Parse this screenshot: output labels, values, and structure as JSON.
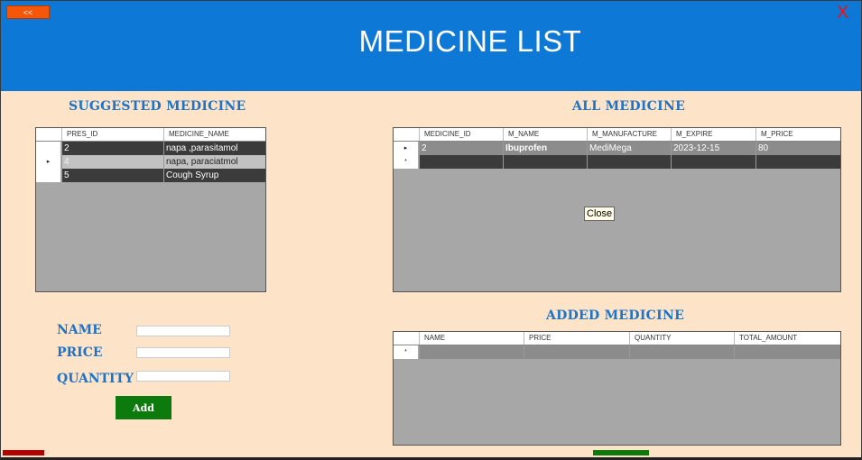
{
  "header": {
    "back_label": "<<",
    "title": "MEDICINE LIST",
    "close_label": "X"
  },
  "colors": {
    "header_bg": "#0e78d6",
    "page_bg": "#fde3c8",
    "accent_text": "#1c73c7",
    "add_button": "#0c7a0c",
    "back_button": "#f5570a",
    "close_x": "#ee1111"
  },
  "suggested": {
    "title": "SUGGESTED MEDICINE",
    "columns": [
      "PRES_ID",
      "MEDICINE_NAME"
    ],
    "rows": [
      {
        "marker": "",
        "cells": [
          "2",
          "napa ,parasitamol"
        ]
      },
      {
        "marker": "▸",
        "cells": [
          "4",
          "napa, paraciatmol"
        ]
      },
      {
        "marker": "",
        "cells": [
          "5",
          "Cough Syrup"
        ]
      }
    ]
  },
  "all": {
    "title": "ALL MEDICINE",
    "columns": [
      "MEDICINE_ID",
      "M_NAME",
      "M_MANUFACTURE",
      "M_EXPIRE",
      "M_PRICE"
    ],
    "rows": [
      {
        "marker": "▸",
        "cells": [
          "2",
          "Ibuprofen",
          "MediMega",
          "2023-12-15",
          "80"
        ]
      },
      {
        "marker": "*",
        "cells": [
          "",
          "",
          "",
          "",
          ""
        ]
      }
    ]
  },
  "added": {
    "title": "ADDED MEDICINE",
    "columns": [
      "NAME",
      "PRICE",
      "QUANTITY",
      "TOTAL_AMOUNT"
    ],
    "rows": [
      {
        "marker": "*",
        "cells": [
          "",
          "",
          "",
          ""
        ]
      }
    ]
  },
  "form": {
    "name_label": "NAME",
    "price_label": "PRICE",
    "quantity_label": "QUANTITY",
    "name_value": "",
    "price_value": "",
    "quantity_value": "",
    "add_label": "Add"
  },
  "tooltip": "Close"
}
